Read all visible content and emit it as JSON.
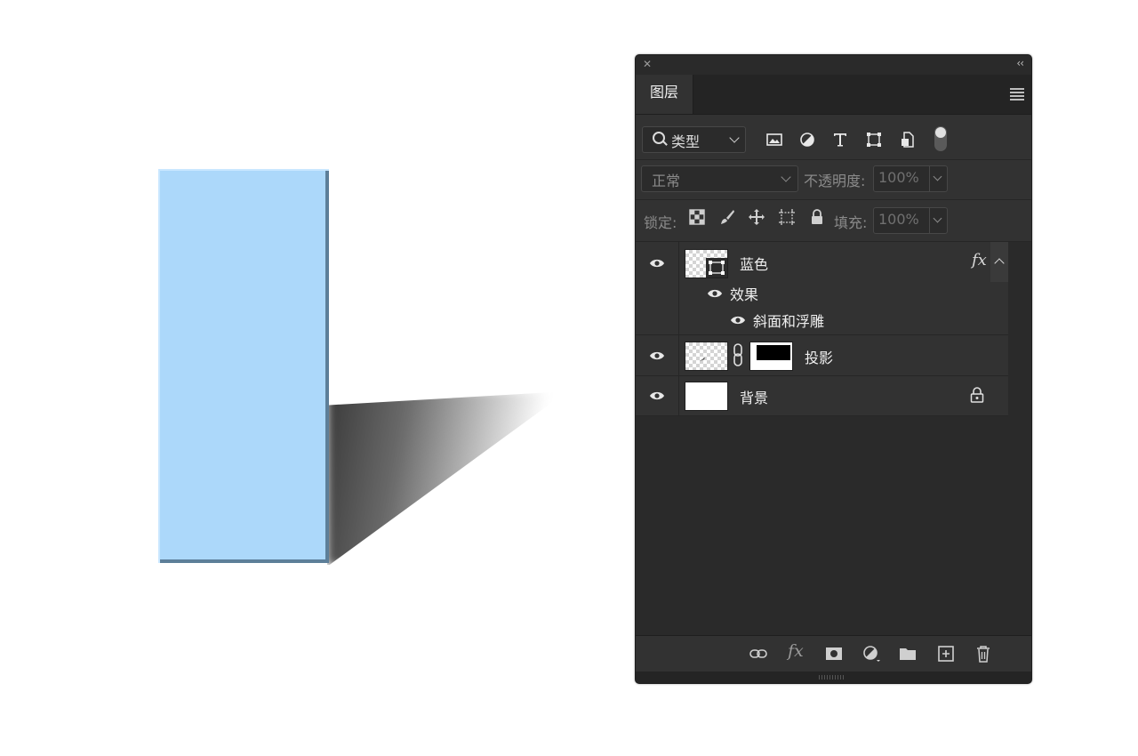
{
  "panel": {
    "tab_label": "图层",
    "filter": {
      "label": "类型"
    },
    "blend": {
      "mode": "正常",
      "opacity_label": "不透明度:",
      "opacity_value": "100%"
    },
    "lock": {
      "label": "锁定:",
      "fill_label": "填充:",
      "fill_value": "100%"
    },
    "layers": [
      {
        "name": "蓝色",
        "fx": "fx",
        "effects_label": "效果",
        "effect": "斜面和浮雕"
      },
      {
        "name": "投影"
      },
      {
        "name": "背景"
      }
    ],
    "bottom": {
      "fx": "fx"
    }
  },
  "colors": {
    "rect_fill": "#acd8fa",
    "panel_bg": "#2a2a2a",
    "row_bg": "#323232"
  },
  "icons": {
    "filter": [
      "search-icon",
      "image-filter-icon",
      "adjustment-filter-icon",
      "type-filter-icon",
      "shape-filter-icon",
      "smart-object-filter-icon"
    ],
    "lock": [
      "lock-transparent-icon",
      "lock-paint-icon",
      "lock-position-icon",
      "lock-artboard-icon",
      "lock-all-icon"
    ],
    "bottom": [
      "link-icon",
      "fx-icon",
      "mask-icon",
      "adjustment-icon",
      "folder-icon",
      "new-layer-icon",
      "trash-icon"
    ]
  }
}
